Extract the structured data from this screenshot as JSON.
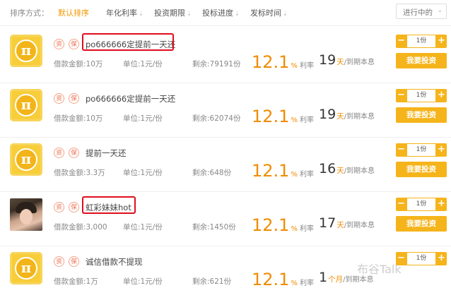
{
  "sort_bar": {
    "label": "排序方式：",
    "options": [
      {
        "label": "默认排序",
        "arrow": "",
        "active": true
      },
      {
        "label": "年化利率",
        "arrow": "⇣",
        "active": false
      },
      {
        "label": "投资期限",
        "arrow": "⇣",
        "active": false
      },
      {
        "label": "投标进度",
        "arrow": "⇣",
        "active": false
      },
      {
        "label": "发标时间",
        "arrow": "⇣",
        "active": false
      }
    ],
    "status_filter": {
      "value": "进行中的",
      "chevron": "⌄"
    }
  },
  "tag_labels": {
    "zi": "资",
    "bao": "保"
  },
  "stepper_labels": {
    "minus": "−",
    "plus": "+"
  },
  "invest_label": "我要投资",
  "logo_glyph": "π",
  "loans": [
    {
      "avatar_type": "pi-logo",
      "title": "po666666定提前一天还",
      "amount": "借款金额:10万",
      "unit": "单位:1元/份",
      "remaining": "剩余:79191份",
      "rate_value": "12.1",
      "rate_symbol": "%",
      "rate_label": "利率",
      "term_value": "19",
      "term_unit": "天",
      "term_label": "/到期本息",
      "quantity": "1份",
      "highlighted": true
    },
    {
      "avatar_type": "pi-logo",
      "title": "po666666定提前一天还",
      "amount": "借款金额:10万",
      "unit": "单位:1元/份",
      "remaining": "剩余:62074份",
      "rate_value": "12.1",
      "rate_symbol": "%",
      "rate_label": "利率",
      "term_value": "19",
      "term_unit": "天",
      "term_label": "/到期本息",
      "quantity": "1份",
      "highlighted": false
    },
    {
      "avatar_type": "pi-logo",
      "title": "提前一天还",
      "amount": "借款金额:3.3万",
      "unit": "单位:1元/份",
      "remaining": "剩余:648份",
      "rate_value": "12.1",
      "rate_symbol": "%",
      "rate_label": "利率",
      "term_value": "16",
      "term_unit": "天",
      "term_label": "/到期本息",
      "quantity": "1份",
      "highlighted": false
    },
    {
      "avatar_type": "photo",
      "title": "虹彩妹妹hot",
      "amount": "借款金额:3,000",
      "unit": "单位:1元/份",
      "remaining": "剩余:1450份",
      "rate_value": "12.1",
      "rate_symbol": "%",
      "rate_label": "利率",
      "term_value": "17",
      "term_unit": "天",
      "term_label": "/到期本息",
      "quantity": "1份",
      "highlighted": true
    },
    {
      "avatar_type": "pi-logo",
      "title": "诚信借款不提现",
      "amount": "借款金额:1万",
      "unit": "单位:1元/份",
      "remaining": "剩余:621份",
      "rate_value": "12.1",
      "rate_symbol": "%",
      "rate_label": "利率",
      "term_value": "1",
      "term_unit": "个月",
      "term_label": "/到期本息",
      "quantity": "1份",
      "highlighted": false
    }
  ],
  "watermark": "布谷Talk",
  "colors": {
    "accent": "#f5b41b",
    "rate": "#f08c00",
    "highlight_box": "#e00d1f"
  }
}
